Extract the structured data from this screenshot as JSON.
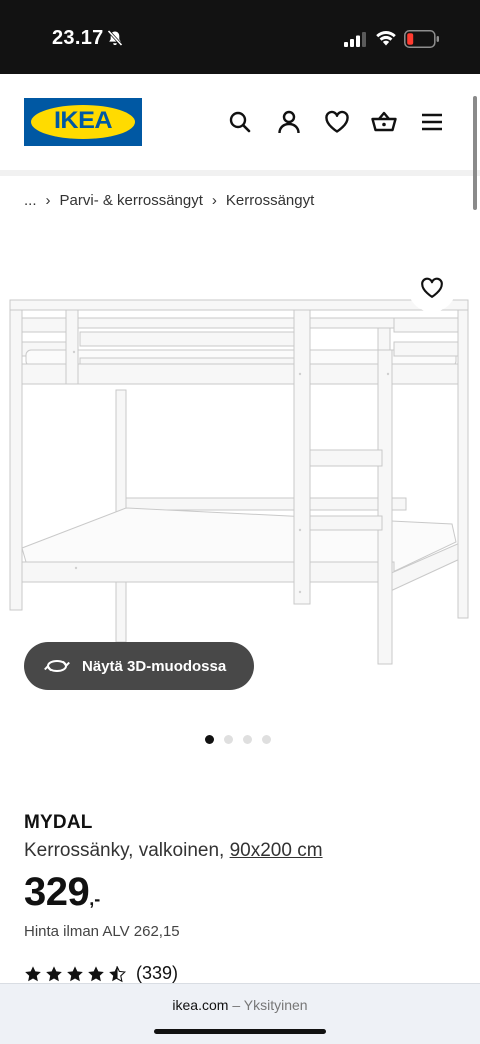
{
  "status_bar": {
    "time": "23.17",
    "icons": [
      "bell-muted-icon",
      "cellular-signal-icon",
      "wifi-icon",
      "battery-low-icon"
    ],
    "battery_color": "#ff3b30"
  },
  "header": {
    "logo_text": "IKEA",
    "icons": [
      "search-icon",
      "account-icon",
      "favourites-icon",
      "shopping-bag-icon",
      "menu-icon"
    ],
    "brand_colors": {
      "blue": "#0058a3",
      "yellow": "#ffdb00"
    }
  },
  "breadcrumb": {
    "ellipsis": "...",
    "items": [
      "Parvi- & kerrossängyt",
      "Kerrossängyt"
    ]
  },
  "media": {
    "view_3d_label": "Näytä 3D-muodossa",
    "carousel": {
      "total": 4,
      "active": 1
    }
  },
  "product": {
    "name": "MYDAL",
    "description": "Kerrossänky, valkoinen,",
    "size": "90x200 cm",
    "price": "329",
    "price_suffix": ",-",
    "vat_text": "Hinta ilman ALV 262,15",
    "rating": {
      "value": 4.5,
      "max": 5,
      "reviews": "(339)"
    }
  },
  "browser": {
    "domain": "ikea.com",
    "separator": "–",
    "mode": "Yksityinen"
  }
}
